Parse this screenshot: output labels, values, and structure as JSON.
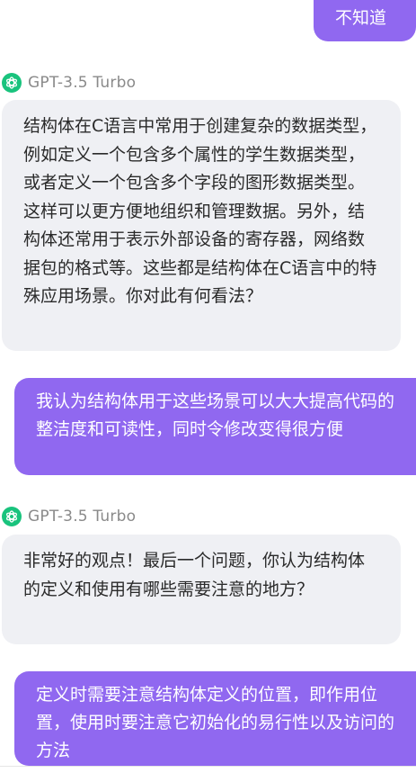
{
  "conversation": {
    "messages": [
      {
        "role": "user",
        "text": "不知道"
      },
      {
        "role": "assistant",
        "model": "GPT-3.5 Turbo",
        "text": "结构体在C语言中常用于创建复杂的数据类型，例如定义一个包含多个属性的学生数据类型，或者定义一个包含多个字段的图形数据类型。这样可以更方便地组织和管理数据。另外，结构体还常用于表示外部设备的寄存器，网络数据包的格式等。这些都是结构体在C语言中的特殊应用场景。你对此有何看法？"
      },
      {
        "role": "user",
        "text": "我认为结构体用于这些场景可以大大提高代码的整洁度和可读性，同时令修改变得很方便"
      },
      {
        "role": "assistant",
        "model": "GPT-3.5 Turbo",
        "text": "非常好的观点！最后一个问题，你认为结构体的定义和使用有哪些需要注意的地方？"
      },
      {
        "role": "user",
        "text": "定义时需要注意结构体定义的位置，即作用位置，使用时要注意它初始化的易行性以及访问的方法"
      }
    ]
  },
  "theme": {
    "user_bubble_color": "#9068f0",
    "assistant_bubble_color": "#eff0f4",
    "model_icon_color": "#19c37d"
  },
  "icons": {
    "model_icon": "openai-logo-icon"
  }
}
